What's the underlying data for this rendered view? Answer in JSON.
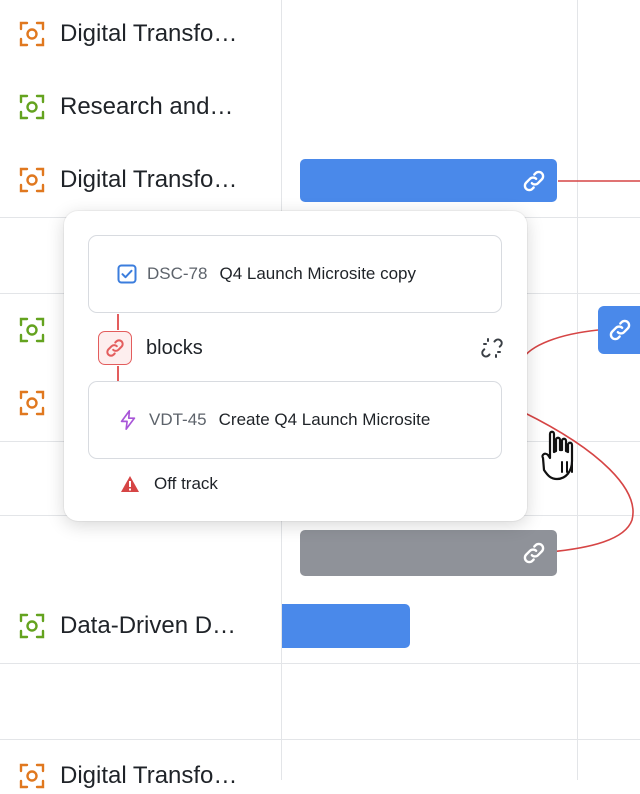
{
  "rows": [
    {
      "label": "Digital Transfo…",
      "icon": "target-icon",
      "color": "#e0781f"
    },
    {
      "label": "Research and…",
      "icon": "target-icon",
      "color": "#64a31f"
    },
    {
      "label": "Digital Transfo…",
      "icon": "target-icon",
      "color": "#e0781f"
    },
    {
      "label": "Data-Driven D…",
      "icon": "target-icon",
      "color": "#64a31f"
    },
    {
      "label": "Digital Transfo…",
      "icon": "target-icon",
      "color": "#e0781f"
    }
  ],
  "popover": {
    "source": {
      "key": "DSC-78",
      "title": "Q4 Launch Microsite copy",
      "icon": "checkbox-icon",
      "color": "#3b7ddd"
    },
    "relation": {
      "label": "blocks",
      "icon": "link-icon",
      "color": "#e35d5d"
    },
    "target": {
      "key": "VDT-45",
      "title": "Create Q4 Launch Microsite",
      "icon": "lightning-icon",
      "color": "#a855d8"
    },
    "status": {
      "label": "Off track",
      "icon": "warning-icon",
      "color": "#d64545"
    }
  },
  "colors": {
    "bar_blue": "#4a89ea",
    "bar_gray": "#8f9299",
    "dependency_line": "#d64545"
  }
}
